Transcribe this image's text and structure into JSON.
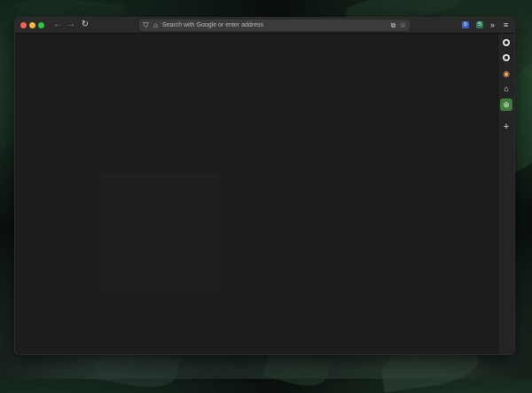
{
  "browser": {
    "url_placeholder": "Search with Google or enter address",
    "toolbar": {
      "back_glyph": "←",
      "forward_glyph": "→",
      "reload_glyph": "↻",
      "shield_glyph": "⛉",
      "page_glyph": "⌂",
      "translate_glyph": "⧉",
      "star_glyph": "☆",
      "overflow_glyph": "»",
      "menu_glyph": "≡"
    },
    "extensions": [
      {
        "icon": "bitwarden-icon",
        "glyph": "b",
        "color": "#3b5fbf"
      },
      {
        "icon": "s-extension-icon",
        "glyph": "S",
        "color": "#2f7a57"
      }
    ],
    "sidebar": {
      "items": [
        {
          "name": "github-icon"
        },
        {
          "name": "github-icon"
        },
        {
          "name": "chrome-icon",
          "glyph": "◉"
        },
        {
          "name": "home-icon",
          "glyph": "⌂"
        },
        {
          "name": "globe-icon",
          "glyph": "⊕",
          "active": true
        }
      ],
      "add_glyph": "+"
    }
  }
}
